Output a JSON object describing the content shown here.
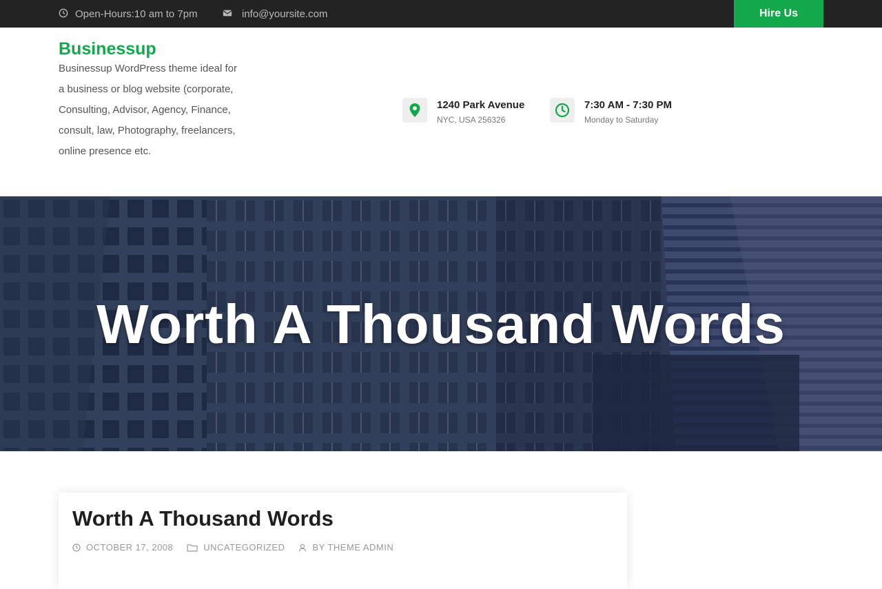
{
  "topbar": {
    "hours_text": "Open-Hours:10 am to 7pm",
    "email_text": "info@yoursite.com",
    "hire_label": "Hire Us"
  },
  "header": {
    "site_title": "Businessup",
    "tagline": "Businessup WordPress theme ideal for a business or blog website (corporate, Consulting, Advisor, Agency, Finance, consult, law, Photography, freelancers, online presence etc.",
    "address": {
      "line1": "1240 Park Avenue",
      "line2": "NYC, USA 256326",
      "icon": "map-pin-icon"
    },
    "hours": {
      "line1": "7:30 AM - 7:30 PM",
      "line2": "Monday to Saturday",
      "icon": "clock-icon"
    }
  },
  "hero": {
    "title": "Worth A Thousand Words"
  },
  "post": {
    "title": "Worth A Thousand Words",
    "date": "OCTOBER 17, 2008",
    "category": "UNCATEGORIZED",
    "author": "BY THEME ADMIN"
  },
  "colors": {
    "accent": "#12a84b",
    "topbar_bg": "#232323"
  }
}
